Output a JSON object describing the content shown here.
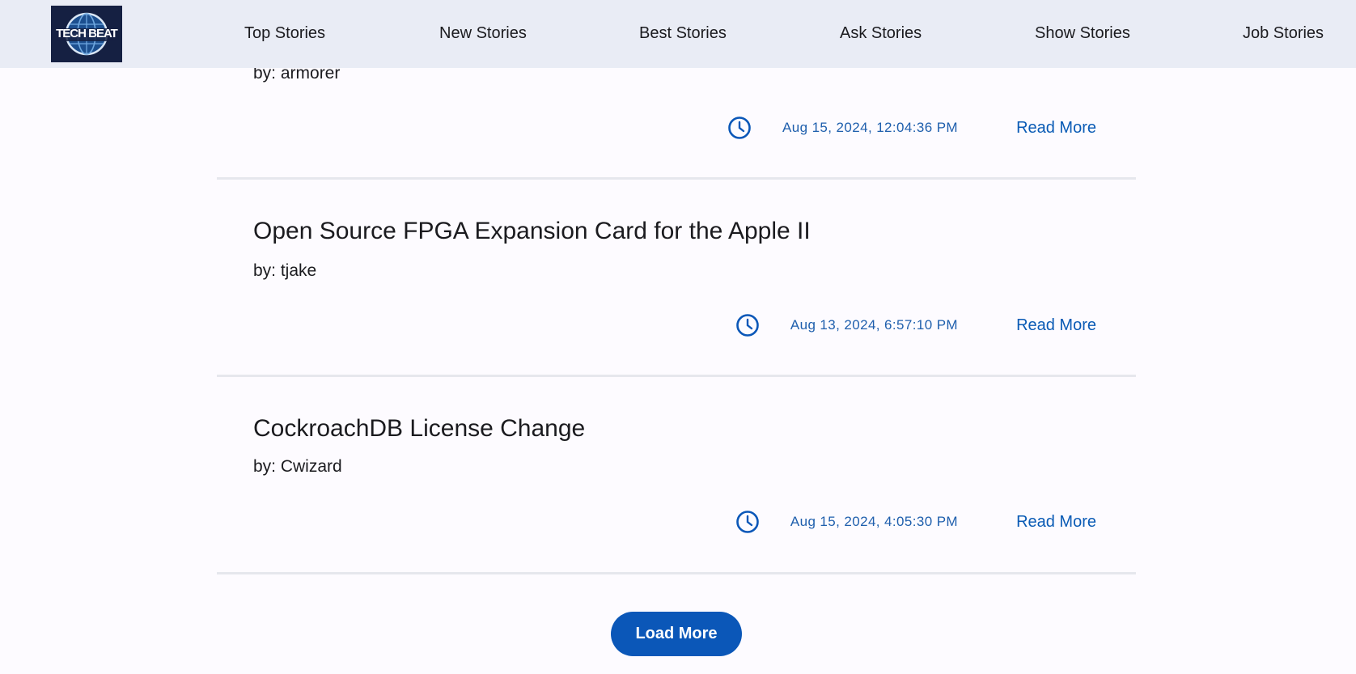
{
  "brand": {
    "logo_text": "TECH BEAT"
  },
  "nav": {
    "items": [
      {
        "label": "Top Stories"
      },
      {
        "label": "New Stories"
      },
      {
        "label": "Best Stories"
      },
      {
        "label": "Ask Stories"
      },
      {
        "label": "Show Stories"
      },
      {
        "label": "Job Stories"
      }
    ]
  },
  "stories": [
    {
      "title": "",
      "author": "by: armorer",
      "timestamp": "Aug 15, 2024, 12:04:36 PM",
      "read_more": "Read More"
    },
    {
      "title": "Open Source FPGA Expansion Card for the Apple II",
      "author": "by: tjake",
      "timestamp": "Aug 13, 2024, 6:57:10 PM",
      "read_more": "Read More"
    },
    {
      "title": "CockroachDB License Change",
      "author": "by: Cwizard",
      "timestamp": "Aug 15, 2024, 4:05:30 PM",
      "read_more": "Read More"
    }
  ],
  "load_more": {
    "label": "Load More"
  },
  "colors": {
    "nav_bg": "#e9ecf5",
    "page_bg": "#fdfbff",
    "accent": "#0b57b8",
    "link": "#0a5bb5"
  },
  "icons": {
    "clock": "clock-icon",
    "logo": "globe-logo-icon"
  }
}
